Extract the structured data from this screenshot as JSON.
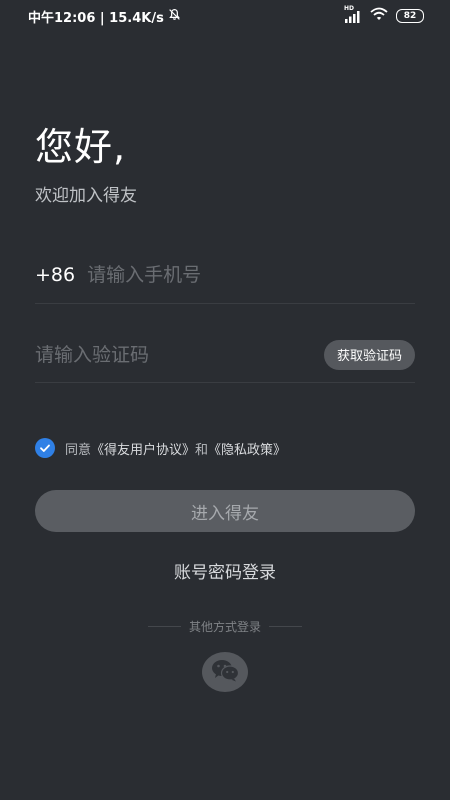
{
  "status_bar": {
    "time_info": "中午12:06 | 15.4K/s",
    "network_label": "HD",
    "battery": "82"
  },
  "header": {
    "greeting": "您好,",
    "subtitle": "欢迎加入得友"
  },
  "phone": {
    "country_code": "+86",
    "placeholder": "请输入手机号",
    "value": ""
  },
  "verification": {
    "placeholder": "请输入验证码",
    "value": "",
    "get_code_label": "获取验证码"
  },
  "agreement": {
    "checked": true,
    "prefix": "同意",
    "user_agreement": "《得友用户协议》",
    "and": "和",
    "privacy_policy": "《隐私政策》"
  },
  "actions": {
    "enter_label": "进入得友",
    "password_login_label": "账号密码登录",
    "other_login_label": "其他方式登录"
  },
  "icons": {
    "checkbox": "check-circle-icon",
    "wechat": "wechat-icon",
    "mute": "bell-off-icon",
    "signal": "signal-icon",
    "wifi": "wifi-icon"
  },
  "colors": {
    "background": "#2a2d32",
    "accent": "#2f80e6",
    "button_disabled": "#5a5d62"
  }
}
